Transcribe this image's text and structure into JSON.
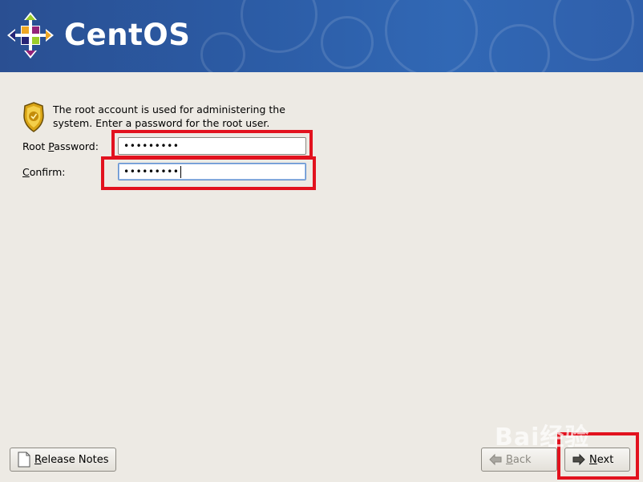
{
  "header": {
    "brand": "CentOS"
  },
  "intro": {
    "text": "The root account is used for administering the system.  Enter a password for the root user."
  },
  "root_password": {
    "label_prefix": "Root ",
    "label_mnemonic": "P",
    "label_suffix": "assword:",
    "value": "•••••••••"
  },
  "confirm": {
    "label_mnemonic": "C",
    "label_suffix": "onfirm:",
    "value": "•••••••••"
  },
  "buttons": {
    "release_notes_mnemonic": "R",
    "release_notes_suffix": "elease Notes",
    "back_mnemonic": "B",
    "back_suffix": "ack",
    "next_mnemonic": "N",
    "next_suffix": "ext"
  },
  "colors": {
    "header_blue": "#2b5aa3",
    "highlight_red": "#e2121e",
    "background": "#edeae4"
  },
  "icons": [
    "centos-logo-icon",
    "security-badge-icon",
    "document-icon",
    "arrow-left-icon",
    "arrow-right-icon"
  ]
}
